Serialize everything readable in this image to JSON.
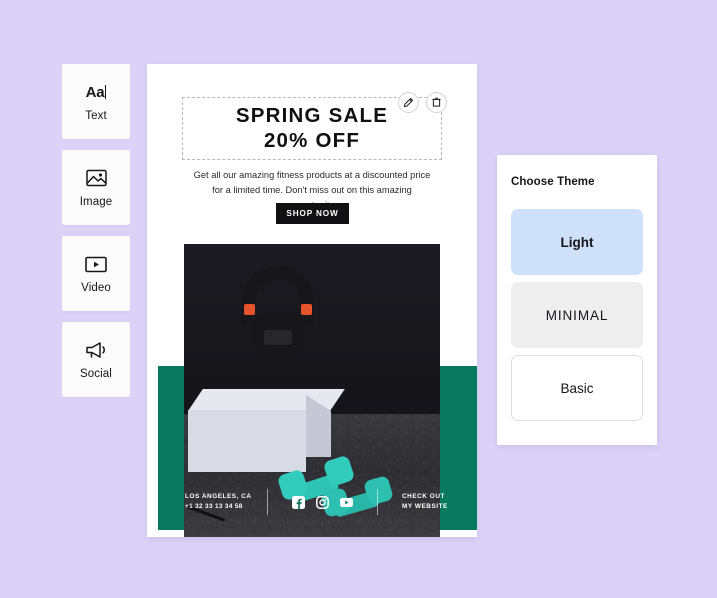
{
  "canvas": {
    "background_color": "#DCD1F7"
  },
  "tool_palette": {
    "items": [
      {
        "label": "Text",
        "icon": "text-aa-icon",
        "glyph": "Aa"
      },
      {
        "label": "Image",
        "icon": "image-icon",
        "glyph": ""
      },
      {
        "label": "Video",
        "icon": "video-play-icon",
        "glyph": ""
      },
      {
        "label": "Social",
        "icon": "megaphone-icon",
        "glyph": ""
      }
    ]
  },
  "poster": {
    "accent_color": "#08795E",
    "headline": {
      "line1": "SPRING SALE",
      "line2": "20% OFF",
      "selected": true
    },
    "actions": [
      {
        "name": "edit",
        "icon": "pencil-icon"
      },
      {
        "name": "delete",
        "icon": "trash-icon"
      }
    ],
    "body_text": "Get all our amazing fitness products at a discounted price for a limited time. Don't miss out on this amazing opportunity.",
    "cta_button": "SHOP NOW",
    "photo": {
      "alt": "Black kettlebell on a white pedestal with two teal dumbbells on a dark gym floor"
    },
    "footer": {
      "city": "LOS ANGELES, CA",
      "phone": "+1 32 33 13 34 58",
      "social": [
        {
          "name": "facebook-icon",
          "label": "Facebook"
        },
        {
          "name": "instagram-icon",
          "label": "Instagram"
        },
        {
          "name": "youtube-icon",
          "label": "YouTube"
        }
      ],
      "cta_line1": "CHECK OUT",
      "cta_line2": "MY WEBSITE"
    }
  },
  "theme_panel": {
    "title": "Choose Theme",
    "options": [
      {
        "label": "Light",
        "swatch": "#CFE0FA",
        "selected": true
      },
      {
        "label": "MINIMAL",
        "swatch": "#EEEEEF",
        "selected": false
      },
      {
        "label": "Basic",
        "swatch": "#FFFFFF",
        "selected": false
      }
    ]
  }
}
